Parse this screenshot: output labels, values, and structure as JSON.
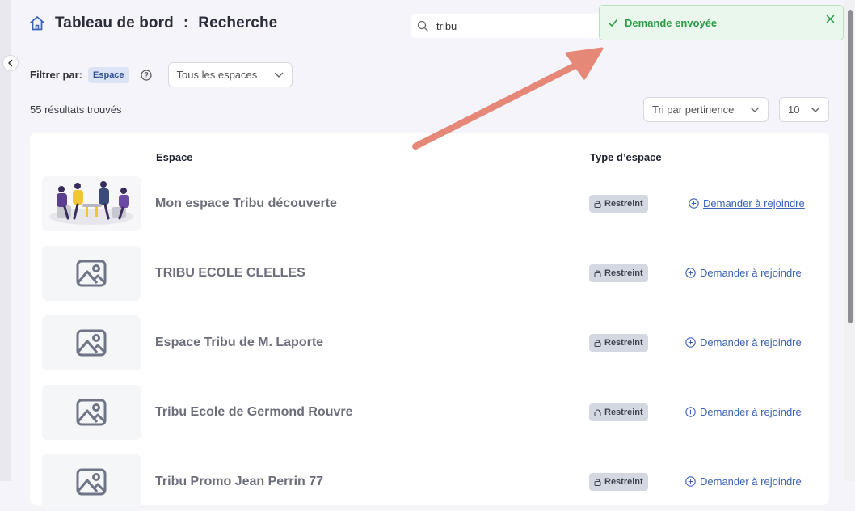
{
  "header": {
    "title": "Tableau de bord",
    "separator": ":",
    "subtitle": "Recherche"
  },
  "search": {
    "value": "tribu",
    "placeholder": ""
  },
  "toast": {
    "message": "Demande envoyée",
    "color": "#2a9d46"
  },
  "filters": {
    "label": "Filtrer par:",
    "chip": "Espace",
    "space_select": "Tous les espaces"
  },
  "results": {
    "count_text": "55 résultats trouvés",
    "sort_select": "Tri par pertinence",
    "page_size": "10"
  },
  "table": {
    "col_space": "Espace",
    "col_type": "Type d’espace",
    "rows": [
      {
        "title": "Mon espace Tribu découverte",
        "type": "Restreint",
        "action": "Demander à rejoindre",
        "thumb": "illustration"
      },
      {
        "title": "TRIBU ECOLE CLELLES",
        "type": "Restreint",
        "action": "Demander à rejoindre",
        "thumb": "image-placeholder-icon"
      },
      {
        "title": "Espace Tribu de M. Laporte",
        "type": "Restreint",
        "action": "Demander à rejoindre",
        "thumb": "image-placeholder-icon"
      },
      {
        "title": "Tribu Ecole de Germond Rouvre",
        "type": "Restreint",
        "action": "Demander à rejoindre",
        "thumb": "image-placeholder-icon"
      },
      {
        "title": "Tribu Promo Jean Perrin 77",
        "type": "Restreint",
        "action": "Demander à rejoindre",
        "thumb": "image-placeholder-icon"
      }
    ]
  },
  "colors": {
    "accent": "#3b63b8",
    "annotation_arrow": "#e58878"
  }
}
